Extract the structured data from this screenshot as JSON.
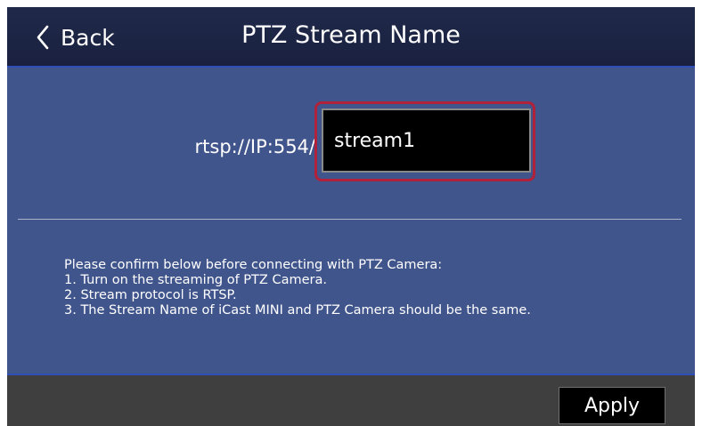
{
  "header": {
    "back_label": "Back",
    "back_icon": "chevron-left-icon",
    "title": "PTZ Stream Name"
  },
  "stream": {
    "url_prefix": "rtsp://IP:554/",
    "name_value": "stream1"
  },
  "notes": {
    "intro": "Please confirm below before connecting with PTZ Camera:",
    "items": [
      "1. Turn on the streaming of PTZ Camera.",
      "2. Stream protocol is RTSP.",
      "3. The Stream Name of iCast MINI and PTZ Camera should be the same."
    ]
  },
  "footer": {
    "apply_label": "Apply"
  },
  "colors": {
    "header_bg": "#1c2344",
    "content_bg": "#41558d",
    "accent_line": "#2f4fb8",
    "focus_border": "#b0223a",
    "footer_bg": "#3f3f3f"
  }
}
